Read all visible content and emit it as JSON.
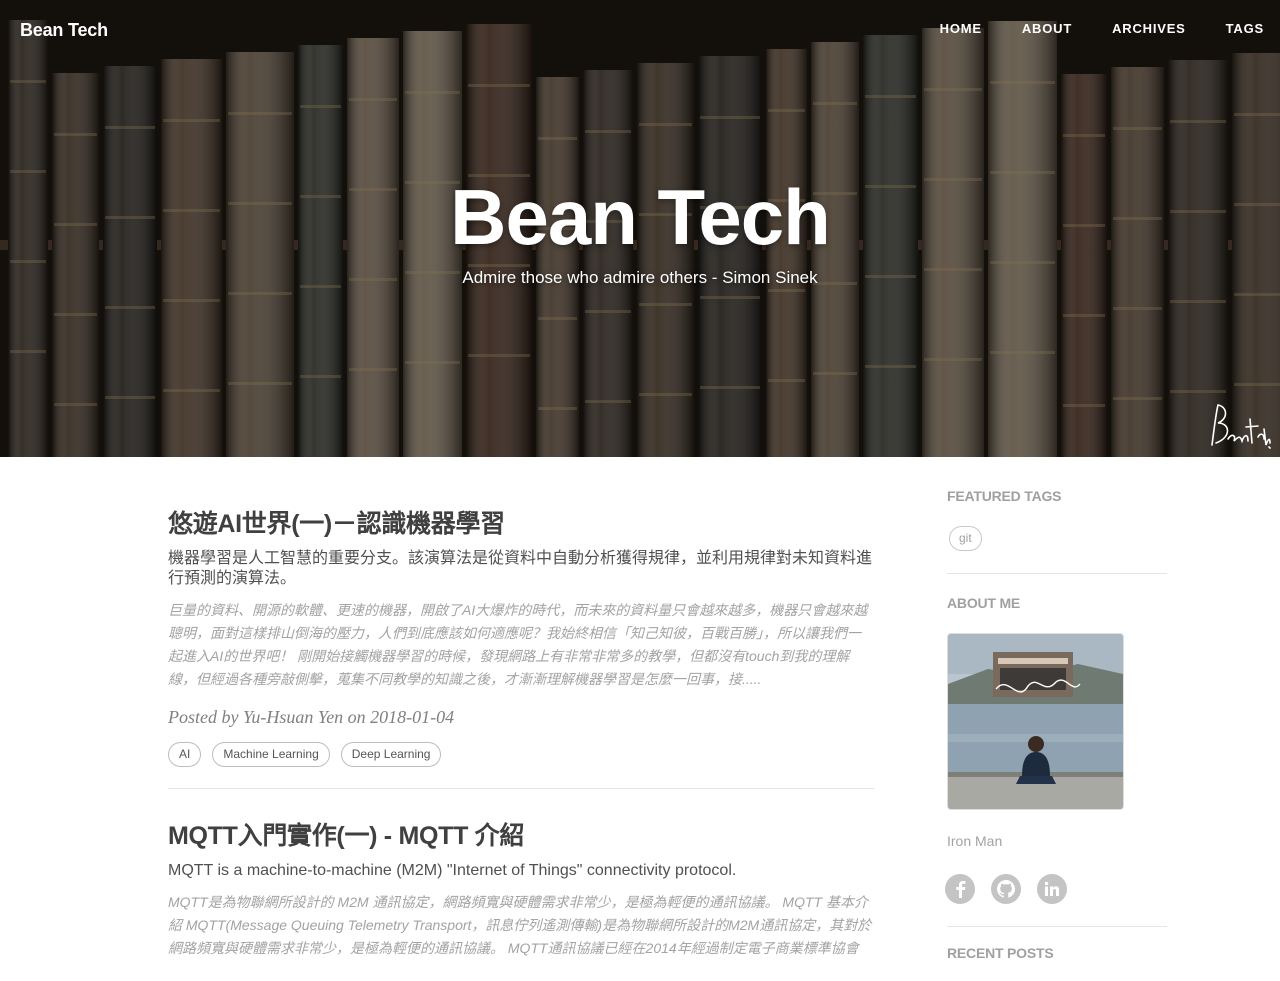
{
  "header": {
    "brand": "Bean Tech",
    "nav": [
      "HOME",
      "ABOUT",
      "ARCHIVES",
      "TAGS"
    ],
    "title": "Bean Tech",
    "subtitle": "Admire those who admire others - Simon Sinek"
  },
  "posts": [
    {
      "title": "悠遊AI世界(一)－認識機器學習",
      "subtitle": "機器學習是人工智慧的重要分支。該演算法是從資料中自動分析獲得規律，並利用規律對未知資料進行預測的演算法。",
      "excerpt": "巨量的資料、開源的軟體、更速的機器，開啟了AI大爆炸的時代，而未來的資料量只會越來越多，機器只會越來越聰明，面對這樣排山倒海的壓力，人們到底應該如何適應呢？我始終相信「知己知彼，百戰百勝」，所以讓我們一起進入AI的世界吧！ 剛開始接觸機器學習的時候，發現網路上有非常非常多的教學，但都沒有touch到我的理解線，但經過各種旁敲側擊，蒐集不同教學的知識之後，才漸漸理解機器學習是怎麼一回事，接.....",
      "meta": "Posted by Yu-Hsuan Yen on 2018-01-04",
      "tags": [
        "AI",
        "Machine Learning",
        "Deep Learning"
      ]
    },
    {
      "title": "MQTT入門實作(一) - MQTT 介紹",
      "subtitle": "MQTT is a machine-to-machine (M2M) \"Internet of Things\" connectivity protocol.",
      "excerpt": "MQTT是為物聯網所設計的 M2M 通訊協定，網路頻寬與硬體需求非常少，是極為輕便的通訊協議。 MQTT 基本介紹 MQTT(Message Queuing Telemetry Transport，訊息佇列遙測傳輸)是為物聯網所設計的M2M通訊協定，其對於網路頻寬與硬體需求非常少，是極為輕便的通訊協議。 MQTT通訊協議已經在2014年經過制定電子商業標準協會"
    }
  ],
  "sidebar": {
    "featured_tags_heading": "FEATURED TAGS",
    "featured_tags": [
      "git"
    ],
    "about_heading": "ABOUT ME",
    "about_name": "Iron Man",
    "social": [
      "facebook-icon",
      "github-icon",
      "linkedin-icon"
    ],
    "recent_heading": "RECENT POSTS"
  }
}
